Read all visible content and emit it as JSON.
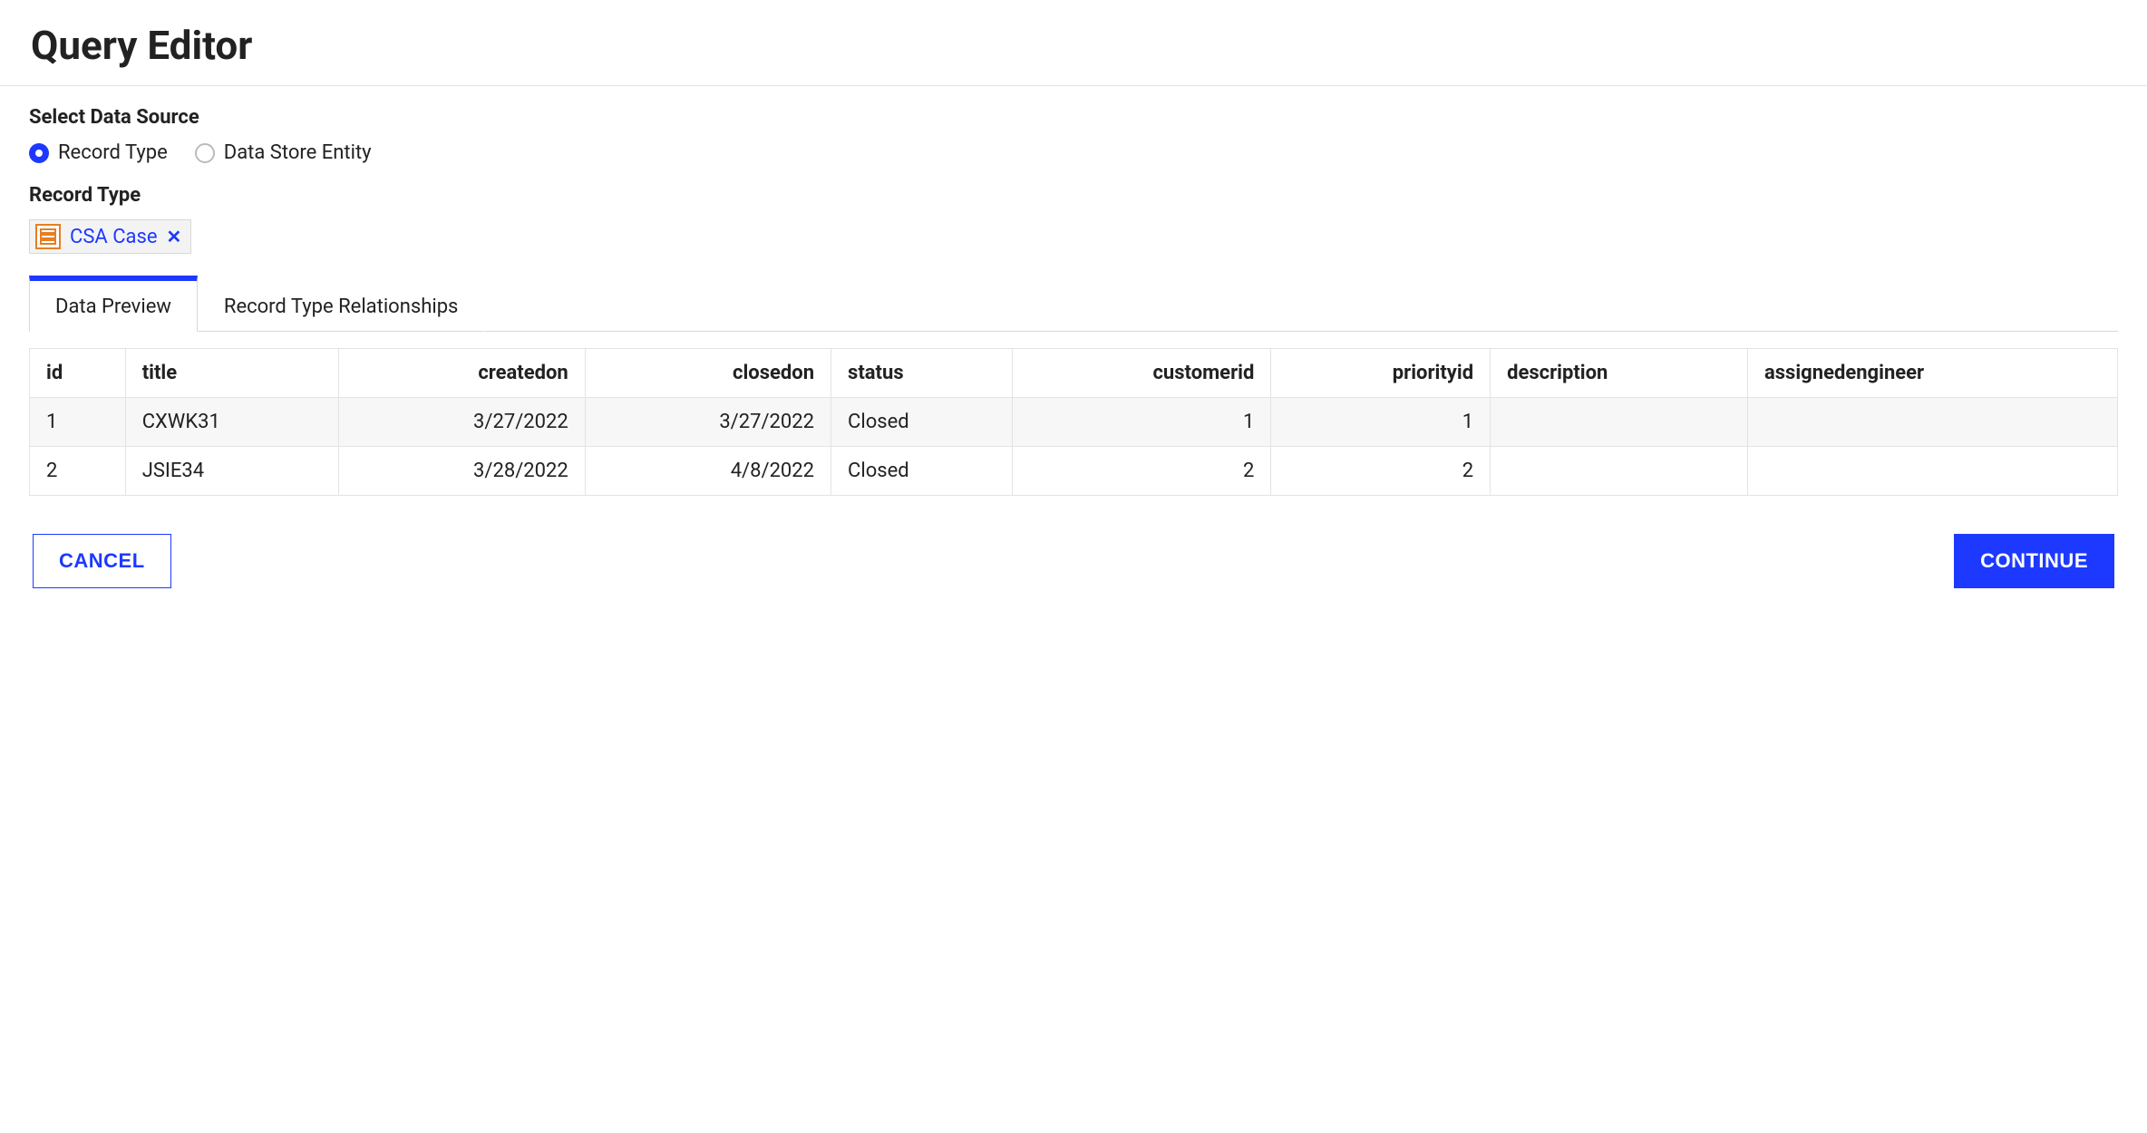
{
  "title": "Query Editor",
  "dataSource": {
    "label": "Select Data Source",
    "options": {
      "recordType": "Record Type",
      "dataStoreEntity": "Data Store Entity"
    },
    "selected": "recordType"
  },
  "recordType": {
    "label": "Record Type",
    "chip": "CSA Case"
  },
  "tabs": {
    "dataPreview": "Data Preview",
    "relationships": "Record Type Relationships",
    "active": "dataPreview"
  },
  "table": {
    "columns": [
      {
        "key": "id",
        "label": "id",
        "align": "left"
      },
      {
        "key": "title",
        "label": "title",
        "align": "left"
      },
      {
        "key": "createdon",
        "label": "createdon",
        "align": "right"
      },
      {
        "key": "closedon",
        "label": "closedon",
        "align": "right"
      },
      {
        "key": "status",
        "label": "status",
        "align": "left"
      },
      {
        "key": "customerid",
        "label": "customerid",
        "align": "right"
      },
      {
        "key": "priorityid",
        "label": "priorityid",
        "align": "right"
      },
      {
        "key": "description",
        "label": "description",
        "align": "left"
      },
      {
        "key": "assignedengineer",
        "label": "assignedengineer",
        "align": "left"
      }
    ],
    "rows": [
      {
        "id": "1",
        "title": "CXWK31",
        "createdon": "3/27/2022",
        "closedon": "3/27/2022",
        "status": "Closed",
        "customerid": "1",
        "priorityid": "1",
        "description": "",
        "assignedengineer": ""
      },
      {
        "id": "2",
        "title": "JSIE34",
        "createdon": "3/28/2022",
        "closedon": "4/8/2022",
        "status": "Closed",
        "customerid": "2",
        "priorityid": "2",
        "description": "",
        "assignedengineer": ""
      }
    ]
  },
  "footer": {
    "cancel": "Cancel",
    "continue": "Continue"
  }
}
